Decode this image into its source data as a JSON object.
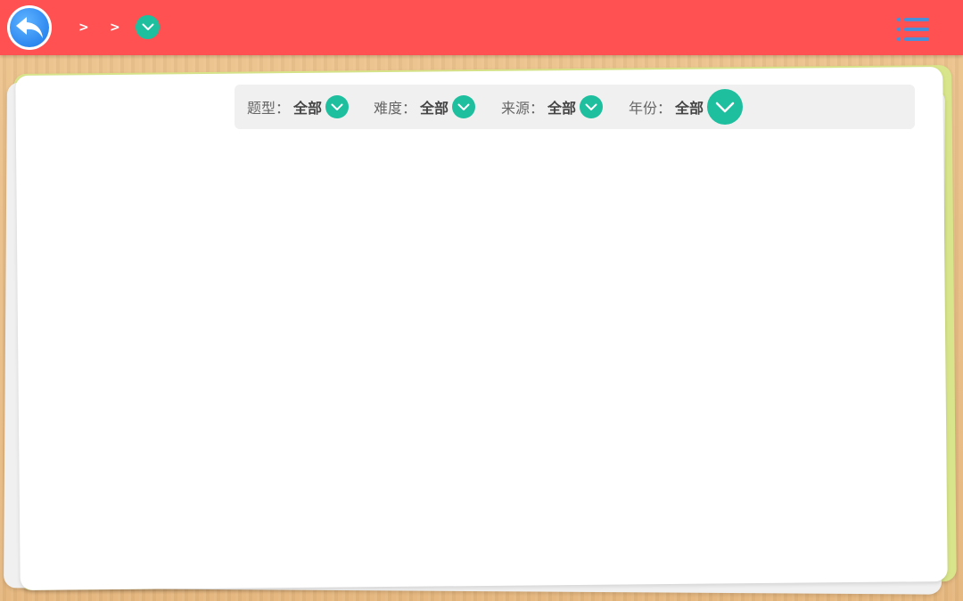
{
  "header": {
    "back_icon": "back-arrow-icon",
    "breadcrumb": {
      "separators": [
        ">",
        ">"
      ],
      "dropdown_icon": "chevron-down-icon"
    },
    "menu_icon": "list-menu-icon",
    "bg_color": "#ff5151"
  },
  "filters": [
    {
      "label": "题型",
      "colon": "：",
      "value": "全部"
    },
    {
      "label": "难度",
      "colon": "：",
      "value": "全部"
    },
    {
      "label": "来源",
      "colon": "：",
      "value": "全部"
    },
    {
      "label": "年份",
      "colon": "：",
      "value": "全部"
    }
  ],
  "colors": {
    "accent": "#1dbf9f",
    "back_button": "#2d88f0",
    "menu_icon": "#4a8fd8",
    "card_green": "#d9e58a"
  }
}
